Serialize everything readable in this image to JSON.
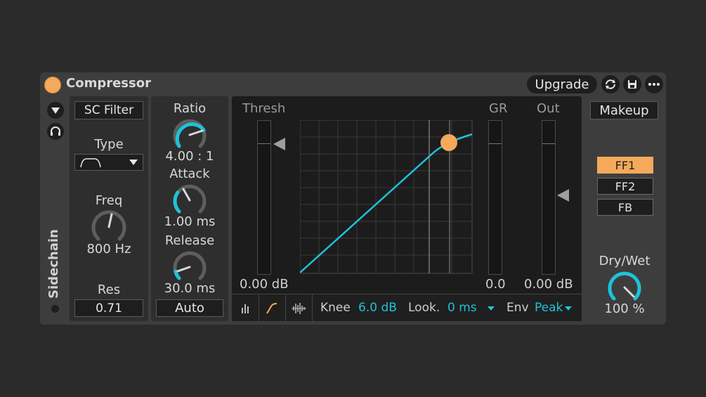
{
  "device": {
    "title": "Compressor",
    "upgrade_label": "Upgrade",
    "icons": [
      "power-icon",
      "swap-icon",
      "save-icon",
      "more-icon"
    ]
  },
  "sidechain": {
    "label": "Sidechain",
    "filter_label": "SC Filter",
    "type_label": "Type",
    "freq_label": "Freq",
    "freq_value": "800 Hz",
    "res_label": "Res",
    "res_value": "0.71"
  },
  "knobs": {
    "ratio_label": "Ratio",
    "ratio_value": "4.00 : 1",
    "attack_label": "Attack",
    "attack_value": "1.00 ms",
    "release_label": "Release",
    "release_value": "30.0 ms",
    "auto_label": "Auto"
  },
  "display": {
    "thresh_label": "Thresh",
    "thresh_value": "0.00 dB",
    "gr_label": "GR",
    "gr_value": "0.0",
    "out_label": "Out",
    "out_value": "0.00 dB",
    "knee_label": "Knee",
    "knee_value": "6.0 dB",
    "look_label": "Look.",
    "look_value": "0 ms",
    "env_label": "Env",
    "env_value": "Peak"
  },
  "right": {
    "makeup_label": "Makeup",
    "ff1": "FF1",
    "ff2": "FF2",
    "fb": "FB",
    "active_mode": "FF1",
    "drywet_label": "Dry/Wet",
    "drywet_value": "100 %"
  },
  "colors": {
    "accent": "#1ec2d9",
    "orange": "#f5a95a"
  }
}
